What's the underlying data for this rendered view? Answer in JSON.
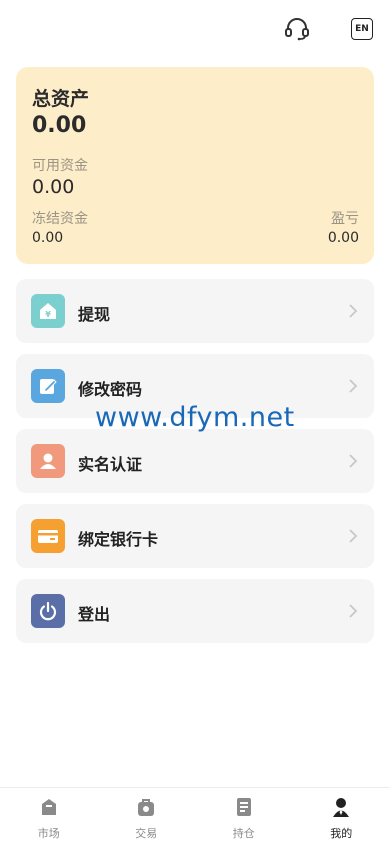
{
  "header": {
    "service_icon": "headset-icon",
    "language_label": "EN"
  },
  "assets": {
    "title": "总资产",
    "total": "0.00",
    "available_label": "可用资金",
    "available_value": "0.00",
    "frozen_label": "冻结资金",
    "frozen_value": "0.00",
    "pnl_label": "盈亏",
    "pnl_value": "0.00"
  },
  "menu": {
    "items": [
      {
        "label": "提现",
        "icon": "withdraw-icon",
        "color": "#7ccfcf"
      },
      {
        "label": "修改密码",
        "icon": "edit-password-icon",
        "color": "#5aa7e0"
      },
      {
        "label": "实名认证",
        "icon": "user-verify-icon",
        "color": "#f0997d"
      },
      {
        "label": "绑定银行卡",
        "icon": "bank-card-icon",
        "color": "#f5a030"
      },
      {
        "label": "登出",
        "icon": "power-icon",
        "color": "#5a6ea8"
      }
    ]
  },
  "watermark": "www.dfym.net",
  "tabbar": {
    "tabs": [
      {
        "label": "市场",
        "icon": "market-icon"
      },
      {
        "label": "交易",
        "icon": "trade-icon"
      },
      {
        "label": "持仓",
        "icon": "positions-icon"
      },
      {
        "label": "我的",
        "icon": "profile-icon",
        "active": true
      }
    ]
  }
}
